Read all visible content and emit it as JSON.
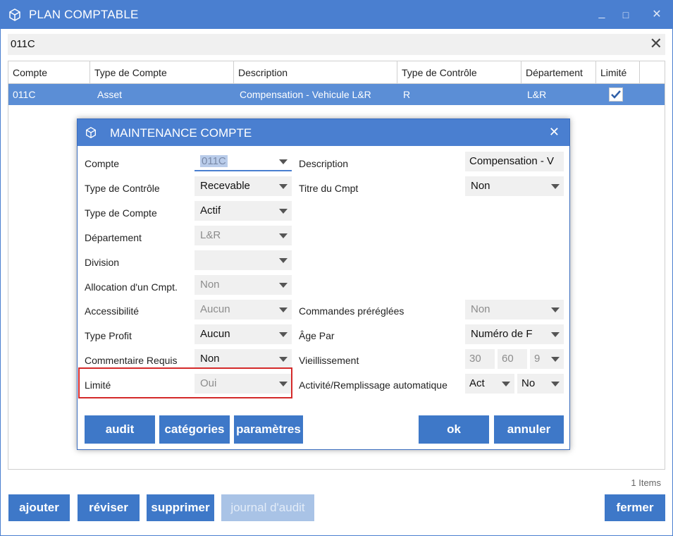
{
  "window": {
    "title": "PLAN COMPTABLE",
    "minimize": "_",
    "maximize": "□",
    "close": "✕"
  },
  "search": {
    "value": "011C",
    "clear": "✕"
  },
  "grid": {
    "headers": [
      "Compte",
      "Type de Compte",
      "Description",
      "Type de Contrôle",
      "Département",
      "Limité"
    ],
    "rows": [
      {
        "compte": "011C",
        "type_compte": "Asset",
        "description": "Compensation - Vehicule L&R",
        "type_controle": "R",
        "departement": "L&R",
        "limite": true
      }
    ],
    "count": "1 Items"
  },
  "colors": {
    "accent": "#4a7fd0",
    "selected_row": "#5b8ed6",
    "button": "#3e78c8",
    "highlight": "#d42a2a"
  },
  "buttons": {
    "ajouter": "ajouter",
    "reviser": "réviser",
    "supprimer": "supprimer",
    "journal": "journal d'audit",
    "fermer": "fermer"
  },
  "dialog": {
    "title": "MAINTENANCE COMPTE",
    "close": "✕",
    "left": {
      "compte": {
        "label": "Compte",
        "value": "011C"
      },
      "type_controle": {
        "label": "Type de Contrôle",
        "value": "Recevable"
      },
      "type_compte": {
        "label": "Type de Compte",
        "value": "Actif"
      },
      "departement": {
        "label": "Département",
        "value": "L&R"
      },
      "division": {
        "label": "Division",
        "value": ""
      },
      "allocation": {
        "label": "Allocation d'un Cmpt.",
        "value": "Non"
      },
      "accessibilite": {
        "label": "Accessibilité",
        "value": "Aucun"
      },
      "type_profit": {
        "label": "Type Profit",
        "value": "Aucun"
      },
      "commentaire": {
        "label": "Commentaire Requis",
        "value": "Non"
      },
      "limite": {
        "label": "Limité",
        "value": "Oui"
      }
    },
    "right": {
      "description": {
        "label": "Description",
        "value": "Compensation - V"
      },
      "titre": {
        "label": "Titre du Cmpt",
        "value": "Non"
      },
      "commandes": {
        "label": "Commandes préréglées",
        "value": "Non"
      },
      "age_par": {
        "label": "Âge Par",
        "value": "Numéro de F"
      },
      "vieillissement": {
        "label": "Vieillissement",
        "v1": "30",
        "v2": "60",
        "v3": "9"
      },
      "activite": {
        "label": "Activité/Remplissage automatique",
        "v1": "Act",
        "v2": "No"
      }
    },
    "buttons": {
      "audit": "audit",
      "categories": "catégories",
      "parametres": "paramètres",
      "ok": "ok",
      "annuler": "annuler"
    }
  }
}
